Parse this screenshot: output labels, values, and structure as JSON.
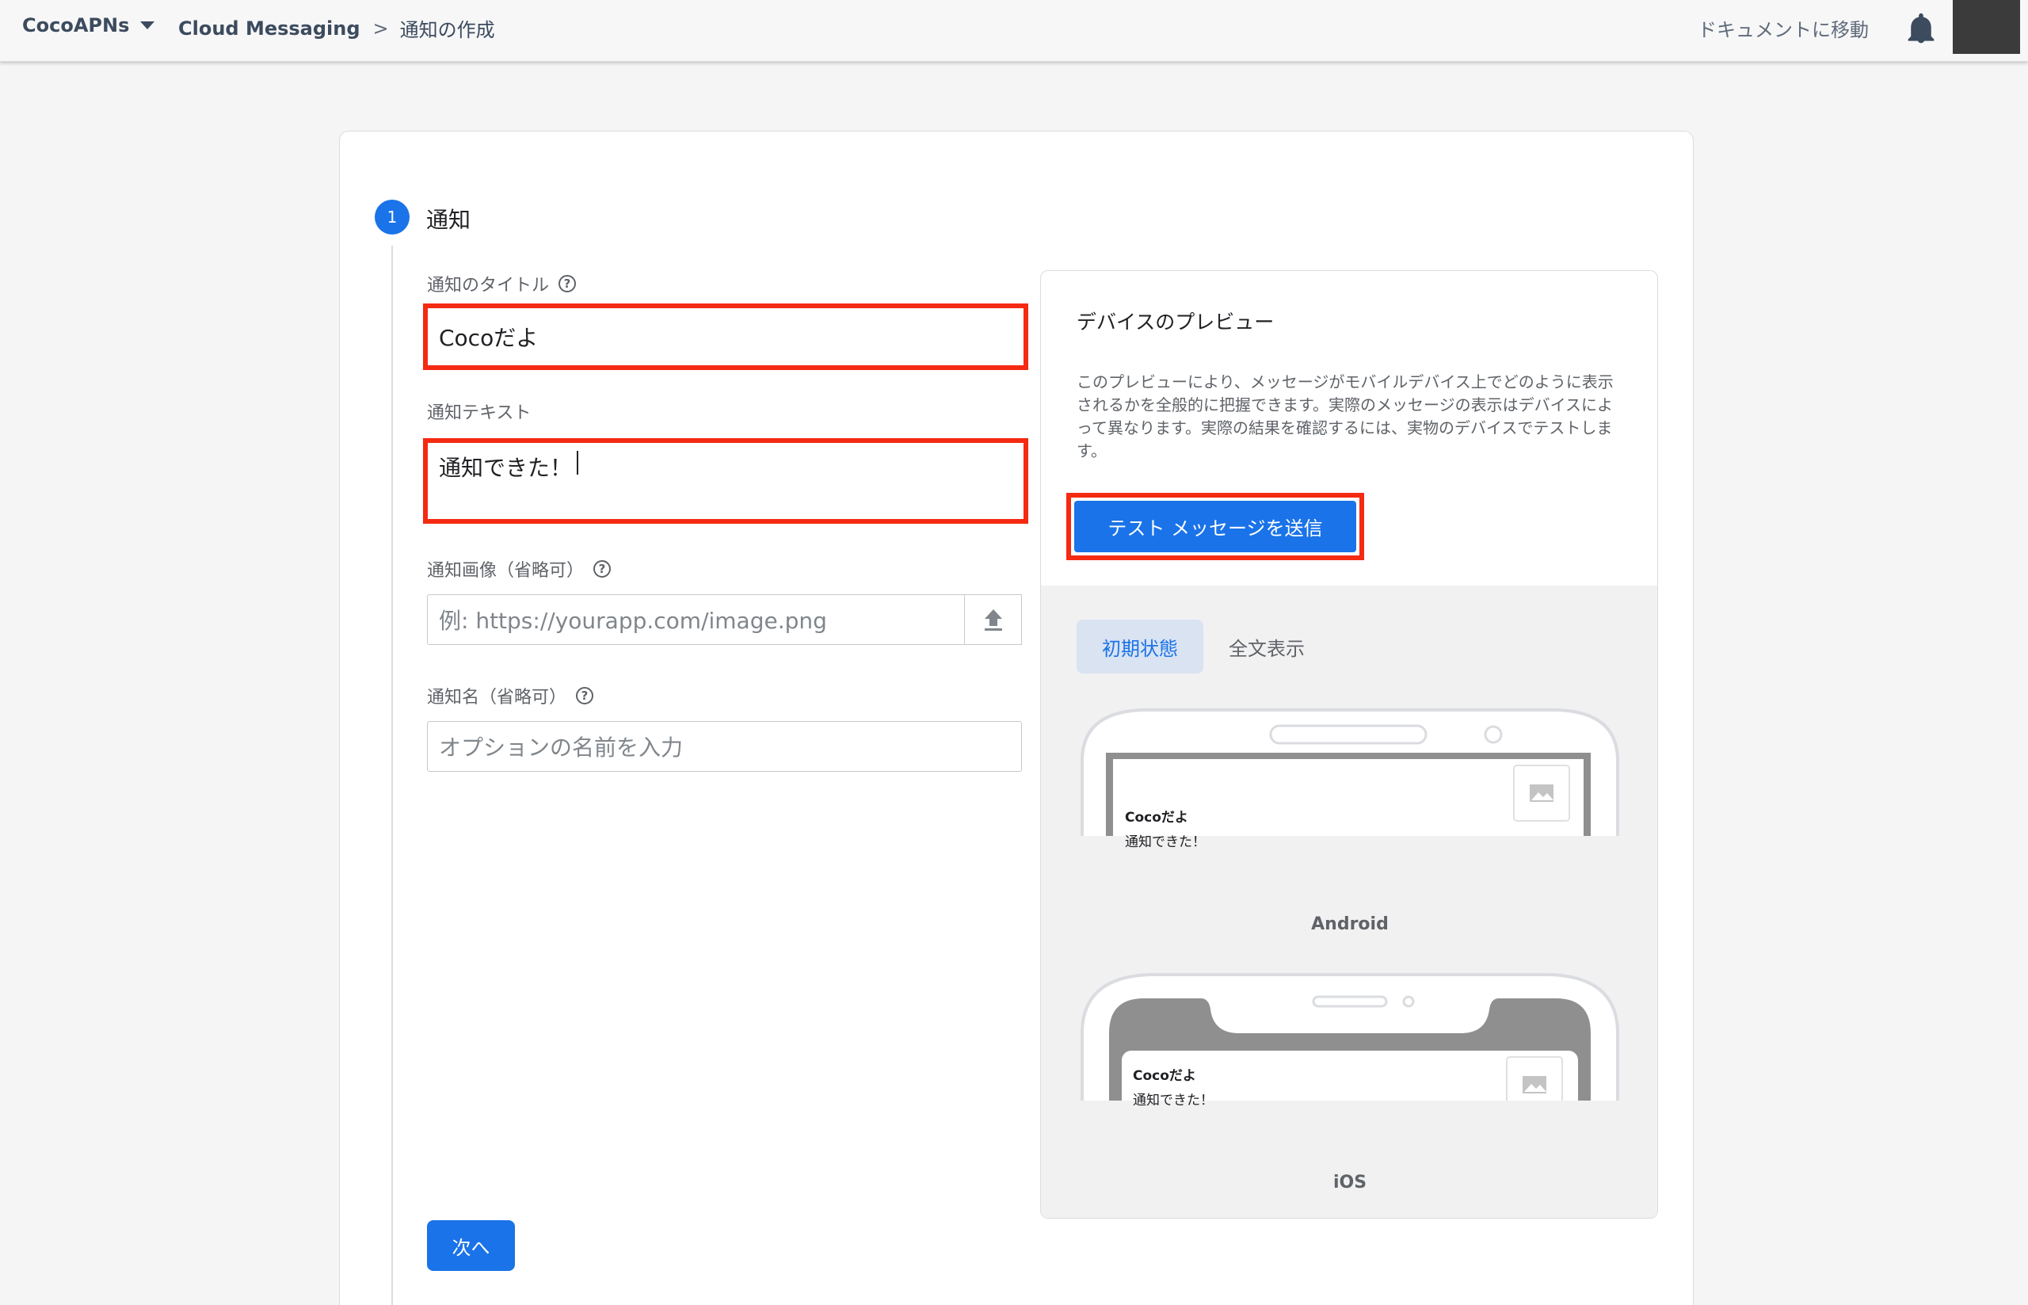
{
  "topbar": {
    "project": "CocoAPNs",
    "breadcrumb_product": "Cloud Messaging",
    "breadcrumb_separator": ">",
    "breadcrumb_page": "通知の作成",
    "docs_link": "ドキュメントに移動"
  },
  "step": {
    "number": "1",
    "title": "通知"
  },
  "form": {
    "title_label": "通知のタイトル",
    "title_value": "Cocoだよ",
    "text_label": "通知テキスト",
    "text_value": "通知できた！",
    "image_label": "通知画像（省略可）",
    "image_placeholder": "例: https://yourapp.com/image.png",
    "name_label": "通知名（省略可）",
    "name_placeholder": "オプションの名前を入力",
    "help_glyph": "?",
    "next_button": "次へ"
  },
  "preview": {
    "title": "デバイスのプレビュー",
    "description": "このプレビューにより、メッセージがモバイルデバイス上でどのように表示されるかを全般的に把握できます。実際のメッセージの表示はデバイスによって異なります。実際の結果を確認するには、実物のデバイスでテストします。",
    "test_button": "テスト メッセージを送信",
    "tabs": [
      {
        "label": "初期状態",
        "active": true
      },
      {
        "label": "全文表示",
        "active": false
      }
    ],
    "android": {
      "label": "Android",
      "notif_title": "Cocoだよ",
      "notif_body": "通知できた！"
    },
    "ios": {
      "label": "iOS",
      "notif_title": "Cocoだよ",
      "notif_body": "通知できた！"
    }
  },
  "colors": {
    "primary": "#1a73e8",
    "highlight": "#f52a12"
  }
}
